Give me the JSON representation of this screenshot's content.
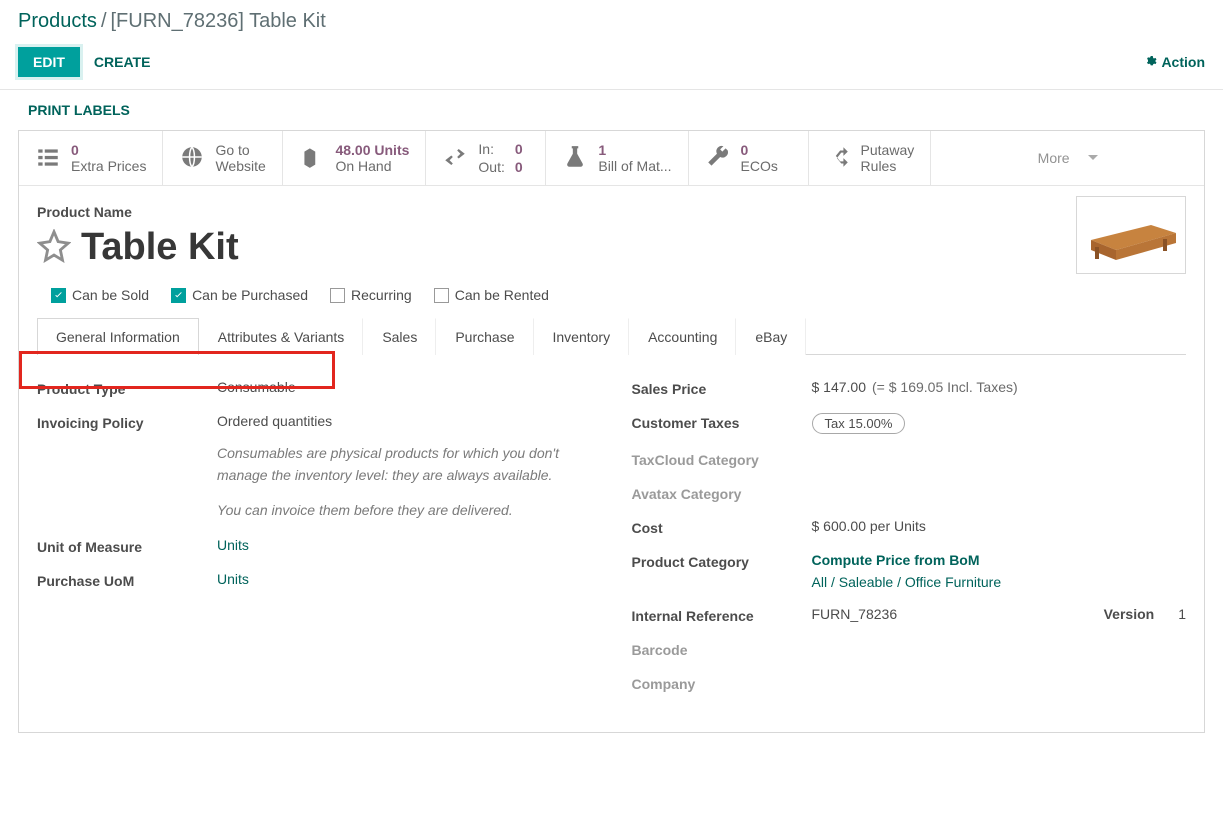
{
  "breadcrumb": {
    "root": "Products",
    "sep": " / ",
    "current": "[FURN_78236] Table Kit"
  },
  "toolbar": {
    "edit": "EDIT",
    "create": "CREATE",
    "action": "Action",
    "print_labels": "PRINT LABELS"
  },
  "stats": {
    "extra_prices": {
      "top": "0",
      "bot": "Extra Prices"
    },
    "website": {
      "top": "Go to",
      "bot": "Website"
    },
    "onhand": {
      "top": "48.00 Units",
      "bot": "On Hand"
    },
    "inout": {
      "in_label": "In:",
      "in_val": "0",
      "out_label": "Out:",
      "out_val": "0"
    },
    "bom": {
      "top": "1",
      "bot": "Bill of Mat..."
    },
    "ecos": {
      "top": "0",
      "bot": "ECOs"
    },
    "putaway": {
      "top": "Putaway",
      "bot": "Rules"
    },
    "more": "More"
  },
  "product": {
    "name_label": "Product Name",
    "name": "Table Kit",
    "checks": {
      "sold": {
        "label": "Can be Sold",
        "checked": true
      },
      "purchased": {
        "label": "Can be Purchased",
        "checked": true
      },
      "recurring": {
        "label": "Recurring",
        "checked": false
      },
      "rented": {
        "label": "Can be Rented",
        "checked": false
      }
    }
  },
  "tabs": [
    "General Information",
    "Attributes & Variants",
    "Sales",
    "Purchase",
    "Inventory",
    "Accounting",
    "eBay"
  ],
  "left": {
    "product_type": {
      "label": "Product Type",
      "value": "Consumable"
    },
    "invoicing_policy": {
      "label": "Invoicing Policy",
      "value": "Ordered quantities",
      "hint1": "Consumables are physical products for which you don't manage the inventory level: they are always available.",
      "hint2": "You can invoice them before they are delivered."
    },
    "uom": {
      "label": "Unit of Measure",
      "value": "Units"
    },
    "purchase_uom": {
      "label": "Purchase UoM",
      "value": "Units"
    }
  },
  "right": {
    "sales_price": {
      "label": "Sales Price",
      "value": "$ 147.00",
      "incl": "(= $ 169.05 Incl. Taxes)"
    },
    "customer_taxes": {
      "label": "Customer Taxes",
      "value": "Tax 15.00%"
    },
    "taxcloud": {
      "label": "TaxCloud Category"
    },
    "avatax": {
      "label": "Avatax Category"
    },
    "cost": {
      "label": "Cost",
      "value": "$ 600.00",
      "per": "per Units",
      "compute": "Compute Price from BoM"
    },
    "category": {
      "label": "Product Category",
      "value": "All / Saleable / Office Furniture"
    },
    "internal_ref": {
      "label": "Internal Reference",
      "value": "FURN_78236",
      "version_label": "Version",
      "version_value": "1"
    },
    "barcode": {
      "label": "Barcode"
    },
    "company": {
      "label": "Company"
    }
  }
}
